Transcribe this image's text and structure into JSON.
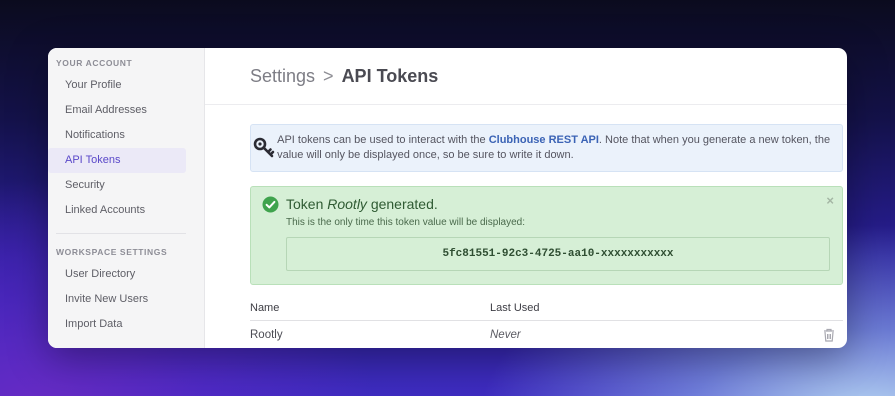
{
  "sidebar": {
    "account_title": "YOUR ACCOUNT",
    "account_items": [
      {
        "label": "Your Profile"
      },
      {
        "label": "Email Addresses"
      },
      {
        "label": "Notifications"
      },
      {
        "label": "API Tokens",
        "active": true
      },
      {
        "label": "Security"
      },
      {
        "label": "Linked Accounts"
      }
    ],
    "workspace_title": "WORKSPACE SETTINGS",
    "workspace_items": [
      {
        "label": "User Directory"
      },
      {
        "label": "Invite New Users"
      },
      {
        "label": "Import Data"
      }
    ]
  },
  "header": {
    "parent": "Settings",
    "separator": ">",
    "current": "API Tokens"
  },
  "info": {
    "text_before": "API tokens can be used to interact with the ",
    "link": "Clubhouse REST API",
    "text_after": ". Note that when you generate a new token, the value will only be displayed once, so be sure to write it down.",
    "icon": "key-icon"
  },
  "success": {
    "title_prefix": "Token ",
    "token_name": "Rootly",
    "title_suffix": " generated.",
    "subtitle": "This is the only time this token value will be displayed:",
    "token_value": "5fc81551-92c3-4725-aa10-xxxxxxxxxxx",
    "close": "×",
    "icon": "check-circle-icon"
  },
  "table": {
    "headers": {
      "name": "Name",
      "last_used": "Last Used"
    },
    "rows": [
      {
        "name": "Rootly",
        "last_used": "Never"
      }
    ]
  },
  "colors": {
    "active_nav": "#5a48c9",
    "link": "#3b63b5",
    "success_bg": "#d6efd6",
    "success_icon": "#3fa34d"
  }
}
